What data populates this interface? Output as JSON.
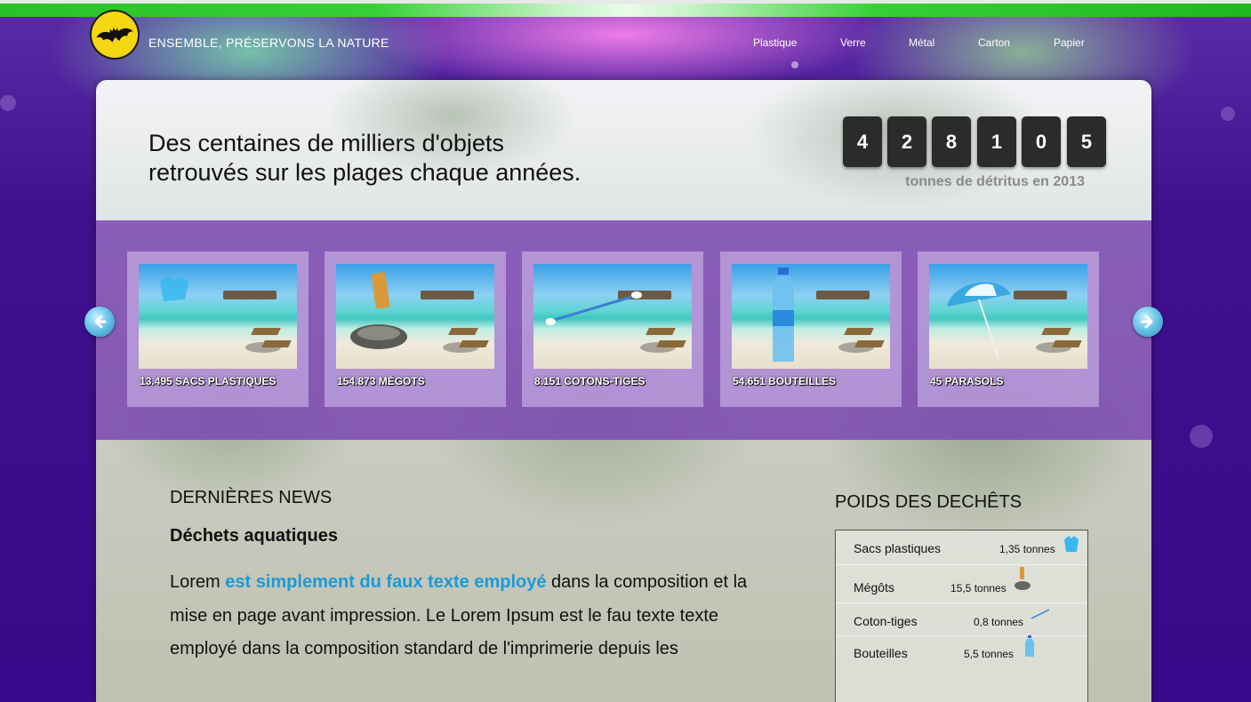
{
  "header": {
    "site_title": "ENSEMBLE, PRÉSERVONS LA NATURE",
    "logo_icon": "batman-logo",
    "nav": [
      {
        "label": "Plastique"
      },
      {
        "label": "Verre"
      },
      {
        "label": "Métal"
      },
      {
        "label": "Carton"
      },
      {
        "label": "Papier"
      }
    ]
  },
  "hero": {
    "headline_line1": "Des centaines de milliers d'objets",
    "headline_line2": "retrouvés sur les plages chaque années.",
    "counter_digits": [
      "4",
      "2",
      "8",
      "1",
      "0",
      "5"
    ],
    "counter_label": "tonnes de détritus en 2013"
  },
  "carousel": {
    "prev_icon": "arrow-left-icon",
    "next_icon": "arrow-right-icon",
    "items": [
      {
        "caption": "13.495 SACS PLASTIQUES",
        "icon": "plastic-bag"
      },
      {
        "caption": "154.873 MÉGOTS",
        "icon": "cigarette-butt"
      },
      {
        "caption": "8.151 COTONS-TIGES",
        "icon": "cotton-swab"
      },
      {
        "caption": "54.651 BOUTEILLES",
        "icon": "water-bottle"
      },
      {
        "caption": "45 PARASOLS",
        "icon": "beach-umbrella"
      }
    ]
  },
  "news": {
    "heading": "DERNIÈRES NEWS",
    "title": "Déchets aquatiques",
    "body_start": "Lorem ",
    "body_highlight": "est simplement du faux texte employé",
    "body_end": " dans la composition et la mise en page avant impression. Le Lorem Ipsum est le fau texte texte employé dans la composition standard de l'imprimerie depuis les"
  },
  "weights": {
    "heading": "POIDS DES DECHÊTS",
    "rows": [
      {
        "name": "Sacs plastiques",
        "value": "1,35 tonnes",
        "icon": "plastic-bag-icon"
      },
      {
        "name": "Mégôts",
        "value": "15,5 tonnes",
        "icon": "cigarette-butt-icon"
      },
      {
        "name": "Coton-tiges",
        "value": "0,8 tonnes",
        "icon": "cotton-swab-icon"
      },
      {
        "name": "Bouteilles",
        "value": "5,5 tonnes",
        "icon": "water-bottle-icon"
      }
    ]
  },
  "colors": {
    "background": "#3b0a8c",
    "accent_green": "#29c229",
    "band_purple": "#7c4ab2",
    "link_blue": "#1a9ad8"
  }
}
